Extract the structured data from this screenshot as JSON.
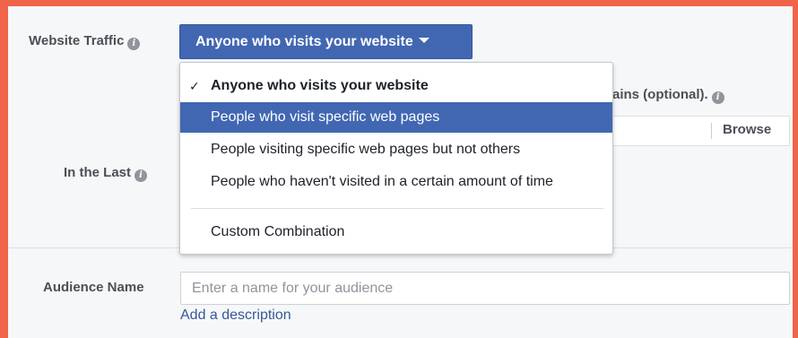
{
  "colors": {
    "frame_border": "#f06449",
    "panel_bg": "#f6f7f9",
    "primary": "#4267b2",
    "link": "#365899",
    "label_text": "#4b4f56",
    "placeholder": "#90949c"
  },
  "traffic": {
    "label": "Website Traffic",
    "info_icon": "info-icon",
    "selected_value": "Anyone who visits your website",
    "dropdown_icon": "caret-down-icon"
  },
  "dropdown": {
    "check_glyph": "✓",
    "options": [
      {
        "label": "Anyone who visits your website",
        "checked": true,
        "highlighted": false
      },
      {
        "label": "People who visit specific web pages",
        "checked": false,
        "highlighted": true
      },
      {
        "label": "People visiting specific web pages but not others",
        "checked": false,
        "highlighted": false
      },
      {
        "label": "People who haven't visited in a certain amount of time",
        "checked": false,
        "highlighted": false
      },
      {
        "label": "Custom Combination",
        "checked": false,
        "highlighted": false
      }
    ]
  },
  "domains": {
    "label_partial": "ains (optional).",
    "browse_label": "Browse"
  },
  "in_the_last": {
    "label": "In the Last"
  },
  "audience": {
    "label": "Audience Name",
    "placeholder": "Enter a name for your audience",
    "value": "",
    "add_description": "Add a description"
  }
}
